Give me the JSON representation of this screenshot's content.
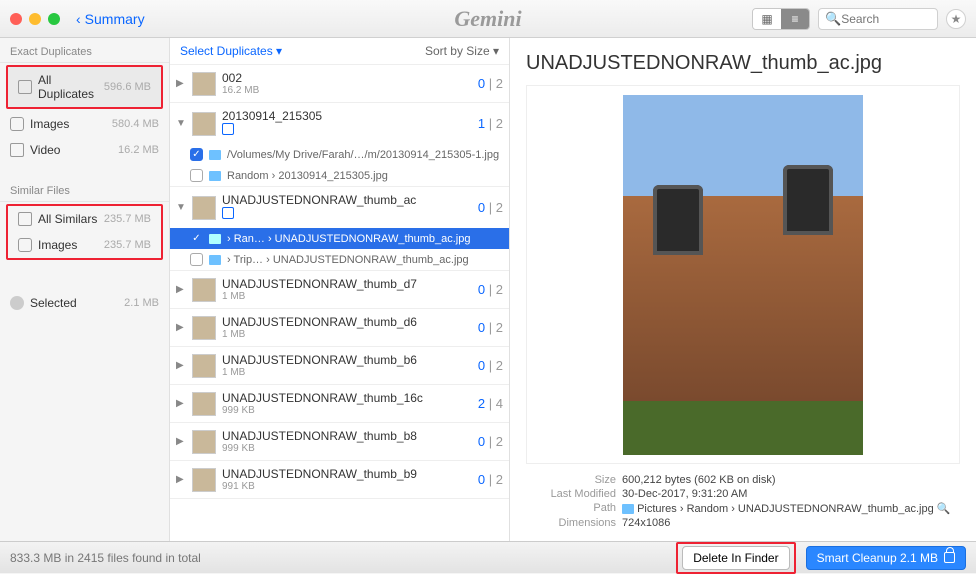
{
  "titlebar": {
    "back_label": "Summary",
    "app_title": "Gemini",
    "search_placeholder": "Search"
  },
  "sidebar": {
    "exact_header": "Exact Duplicates",
    "similar_header": "Similar Files",
    "exact_items": [
      {
        "label": "All Duplicates",
        "size": "596.6 MB"
      },
      {
        "label": "Images",
        "size": "580.4 MB"
      },
      {
        "label": "Video",
        "size": "16.2 MB"
      }
    ],
    "similar_items": [
      {
        "label": "All Similars",
        "size": "235.7 MB"
      },
      {
        "label": "Images",
        "size": "235.7 MB"
      }
    ],
    "selected_label": "Selected",
    "selected_size": "2.1 MB"
  },
  "midpane": {
    "select_label": "Select Duplicates ▾",
    "sort_label": "Sort by Size ▾",
    "groups": [
      {
        "title": "002",
        "sub": "16.2 MB",
        "sel": "0",
        "tot": "2"
      },
      {
        "title": "20130914_215305",
        "sub": "",
        "sel": "1",
        "tot": "2",
        "files": [
          {
            "checked": true,
            "crumb": "/Volumes/My Drive/Farah/…/m/20130914_215305-1.jpg"
          },
          {
            "checked": false,
            "crumb": "Random ›  20130914_215305.jpg"
          }
        ]
      },
      {
        "title": "UNADJUSTEDNONRAW_thumb_ac",
        "sub": "",
        "sel": "0",
        "tot": "2",
        "files": [
          {
            "checked": true,
            "selected": true,
            "crumb": "› Ran… › UNADJUSTEDNONRAW_thumb_ac.jpg"
          },
          {
            "checked": false,
            "crumb": "› Trip… › UNADJUSTEDNONRAW_thumb_ac.jpg"
          }
        ]
      },
      {
        "title": "UNADJUSTEDNONRAW_thumb_d7",
        "sub": "1 MB",
        "sel": "0",
        "tot": "2"
      },
      {
        "title": "UNADJUSTEDNONRAW_thumb_d6",
        "sub": "1 MB",
        "sel": "0",
        "tot": "2"
      },
      {
        "title": "UNADJUSTEDNONRAW_thumb_b6",
        "sub": "1 MB",
        "sel": "0",
        "tot": "2"
      },
      {
        "title": "UNADJUSTEDNONRAW_thumb_16c",
        "sub": "999 KB",
        "sel": "2",
        "tot": "4"
      },
      {
        "title": "UNADJUSTEDNONRAW_thumb_b8",
        "sub": "999 KB",
        "sel": "0",
        "tot": "2"
      },
      {
        "title": "UNADJUSTEDNONRAW_thumb_b9",
        "sub": "991 KB",
        "sel": "0",
        "tot": "2"
      }
    ]
  },
  "preview": {
    "title": "UNADJUSTEDNONRAW_thumb_ac.jpg",
    "meta": {
      "size_label": "Size",
      "size": "600,212 bytes (602 KB on disk)",
      "modified_label": "Last Modified",
      "modified": "30-Dec-2017, 9:31:20 AM",
      "path_label": "Path",
      "path": "Pictures › Random › UNADJUSTEDNONRAW_thumb_ac.jpg",
      "dim_label": "Dimensions",
      "dim": "724x1086"
    }
  },
  "footer": {
    "status": "833.3 MB in 2415 files found in total",
    "delete_label": "Delete In Finder",
    "cleanup_label": "Smart Cleanup 2.1 MB"
  }
}
